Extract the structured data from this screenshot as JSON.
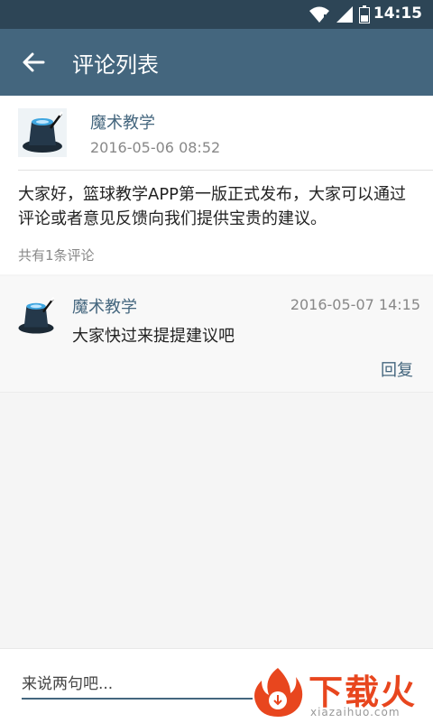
{
  "status_bar": {
    "time": "14:15"
  },
  "app_bar": {
    "title": "评论列表"
  },
  "post": {
    "author": "魔术教学",
    "date": "2016-05-06 08:52",
    "content": "大家好，篮球教学APP第一版正式发布，大家可以通过评论或者意见反馈向我们提供宝贵的建议。",
    "comment_count": "共有1条评论"
  },
  "comments": [
    {
      "author": "魔术教学",
      "date": "2016-05-07 14:15",
      "text": "大家快过来提提建议吧",
      "reply_label": "回复"
    }
  ],
  "input": {
    "placeholder": "来说两句吧..."
  },
  "watermark": {
    "main": "下载火",
    "sub": "xiazaihuo.com"
  },
  "colors": {
    "status_bar": "#2d4556",
    "app_bar": "#44667e",
    "accent": "#44667e",
    "watermark": "#e8461e"
  },
  "icons": {
    "back": "arrow-left-icon",
    "wifi": "wifi-icon",
    "signal": "signal-icon",
    "battery": "battery-icon",
    "avatar": "magic-hat-icon"
  }
}
